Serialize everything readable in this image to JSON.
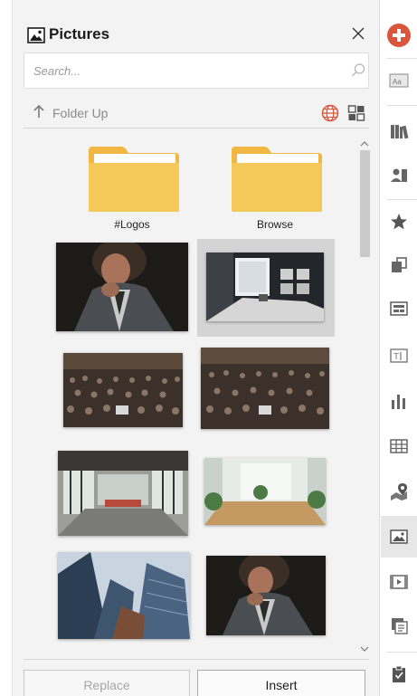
{
  "pane": {
    "title": "Pictures",
    "icon": "picture-icon"
  },
  "search": {
    "placeholder": "Search..."
  },
  "toolbar": {
    "folder_up_label": "Folder Up",
    "globe_icon": "globe-icon",
    "view_icon": "thumbnail-view-icon"
  },
  "folders": [
    {
      "label": "#Logos"
    },
    {
      "label": "Browse"
    }
  ],
  "thumbnails": [
    {
      "subject": "man in suit",
      "selected": false
    },
    {
      "subject": "dark office room",
      "selected": true
    },
    {
      "subject": "lecture hall audience",
      "selected": false
    },
    {
      "subject": "lecture hall audience",
      "selected": false
    },
    {
      "subject": "conference room",
      "selected": false
    },
    {
      "subject": "bright office lounge",
      "selected": false
    },
    {
      "subject": "skyscrapers",
      "selected": false
    },
    {
      "subject": "man in suit",
      "selected": false
    }
  ],
  "buttons": {
    "replace": "Replace",
    "insert": "Insert"
  },
  "rail": {
    "items": [
      "add-circle-icon",
      "text-style-icon",
      "library-icon",
      "people-icon",
      "star-icon",
      "shapes-icon",
      "layout-icon",
      "text-box-icon",
      "bar-chart-icon",
      "table-icon",
      "map-pin-icon",
      "picture-icon",
      "video-icon",
      "notes-icon",
      "clipboard-icon"
    ],
    "active": "picture-icon"
  },
  "colors": {
    "folder": "#f5c85a",
    "folder_tab": "#f2b743",
    "accent_red": "#d9553b",
    "pane_bg": "#f3f3f3"
  }
}
